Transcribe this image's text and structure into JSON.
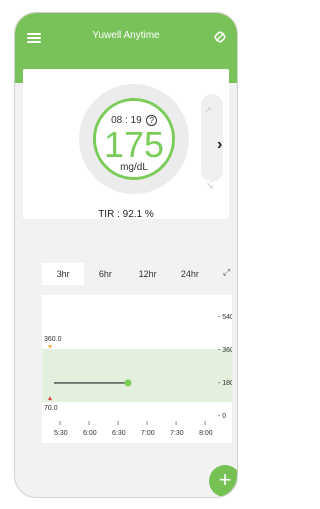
{
  "app": {
    "title": "Yuwell Anytime"
  },
  "glucose": {
    "time": "08 : 19",
    "value": "175",
    "unit": "mg/dL",
    "tir": "TIR :  92.1 %"
  },
  "tabs": [
    {
      "label": "3hr",
      "active": true
    },
    {
      "label": "6hr",
      "active": false
    },
    {
      "label": "12hr",
      "active": false
    },
    {
      "label": "24hr",
      "active": false
    }
  ],
  "colors": {
    "brand": "#79c25a",
    "glucose_ring": "#7ccc5b",
    "low_marker": "#d9413a",
    "high_marker": "#f2b43a"
  },
  "chart_data": {
    "type": "line",
    "title": "",
    "xlabel": "",
    "ylabel": "",
    "x_ticks": [
      "5:30",
      "6:00",
      "6:30",
      "7:00",
      "7:30",
      "8:00"
    ],
    "y_ticks": [
      "540",
      "360",
      "180",
      "0"
    ],
    "ylim": [
      0,
      600
    ],
    "target_range": [
      70,
      360
    ],
    "high_threshold": {
      "value": 360,
      "label": "360.0"
    },
    "low_threshold": {
      "value": 70,
      "label": "70.0"
    },
    "series": [
      {
        "points": [
          [
            0,
            175
          ],
          [
            2.55,
            175
          ]
        ]
      }
    ],
    "current_point": {
      "x": 2.55,
      "y": 175
    }
  }
}
